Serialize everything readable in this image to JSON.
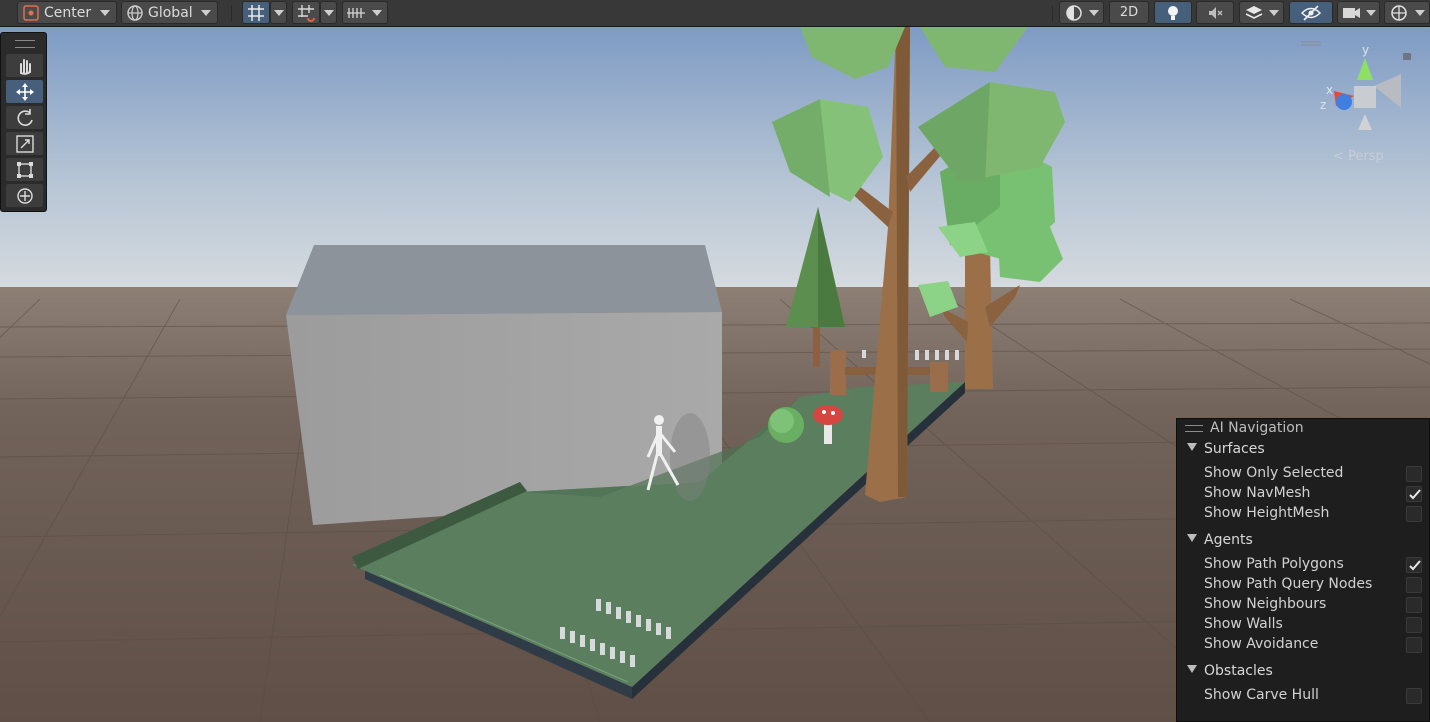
{
  "toolbar": {
    "pivot_mode": "Center",
    "pivot_rotation": "Global",
    "toggle_2d": "2D"
  },
  "gizmo": {
    "axis_y": "y",
    "axis_x": "x",
    "axis_z": "z",
    "projection": "Persp"
  },
  "overlay": {
    "title": "AI Navigation",
    "sections": [
      {
        "title": "Surfaces",
        "options": [
          {
            "label": "Show Only Selected",
            "checked": false
          },
          {
            "label": "Show NavMesh",
            "checked": true
          },
          {
            "label": "Show HeightMesh",
            "checked": false
          }
        ]
      },
      {
        "title": "Agents",
        "options": [
          {
            "label": "Show Path Polygons",
            "checked": true
          },
          {
            "label": "Show Path Query Nodes",
            "checked": false
          },
          {
            "label": "Show Neighbours",
            "checked": false
          },
          {
            "label": "Show Walls",
            "checked": false
          },
          {
            "label": "Show Avoidance",
            "checked": false
          }
        ]
      },
      {
        "title": "Obstacles",
        "options": [
          {
            "label": "Show Carve Hull",
            "checked": false
          }
        ]
      }
    ]
  },
  "colors": {
    "toolbar_bg": "#383838",
    "active_blue": "#46607c",
    "sky_top": "#7e9bc4",
    "ground": "#6b5b4e",
    "navmesh_green": "#5a7e5e"
  }
}
